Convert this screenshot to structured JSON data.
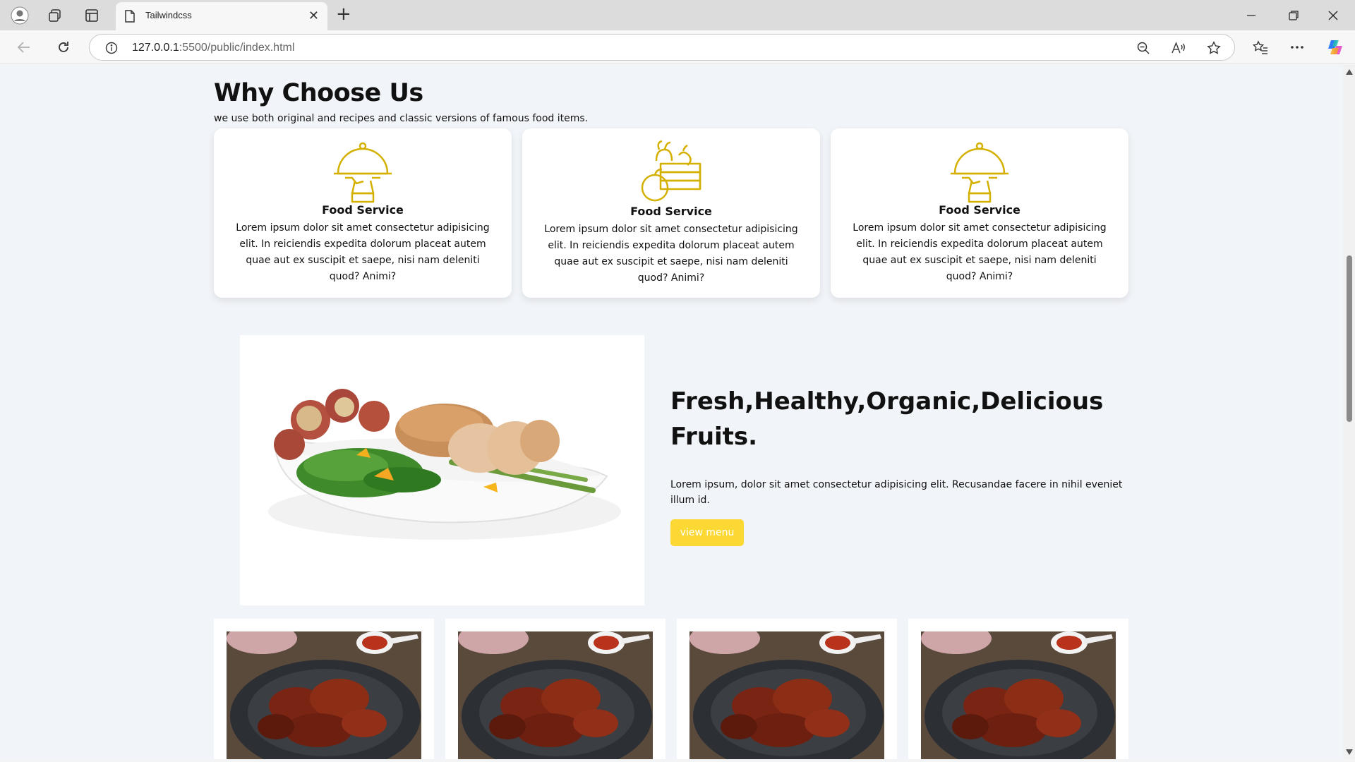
{
  "browser": {
    "tab_title": "Tailwindcss",
    "url_host": "127.0.0.1",
    "url_rest": ":5500/public/index.html"
  },
  "why": {
    "title": "Why Choose Us",
    "subtitle": "we use both original and recipes and classic versions of famous food items.",
    "cards": [
      {
        "icon": "cloche-icon",
        "title": "Food Service",
        "text": "Lorem ipsum dolor sit amet consectetur adipisicing elit. In reiciendis expedita dolorum placeat autem quae aut ex suscipit et saepe, nisi nam deleniti quod? Animi?"
      },
      {
        "icon": "fruit-basket-icon",
        "title": "Food Service",
        "text": "Lorem ipsum dolor sit amet consectetur adipisicing elit. In reiciendis expedita dolorum placeat autem quae aut ex suscipit et saepe, nisi nam deleniti quod? Animi?"
      },
      {
        "icon": "cloche-icon",
        "title": "Food Service",
        "text": "Lorem ipsum dolor sit amet consectetur adipisicing elit. In reiciendis expedita dolorum placeat autem quae aut ex suscipit et saepe, nisi nam deleniti quod? Animi?"
      }
    ]
  },
  "hero": {
    "title": "Fresh,Healthy,Organic,Delicious Fruits.",
    "text": "Lorem ipsum, dolor sit amet consectetur adipisicing elit. Recusandae facere in nihil eveniet illum id.",
    "button": "view menu"
  },
  "colors": {
    "accent": "#fcd835",
    "icon_gold": "#d4b000",
    "page_bg": "#f1f4f8"
  }
}
